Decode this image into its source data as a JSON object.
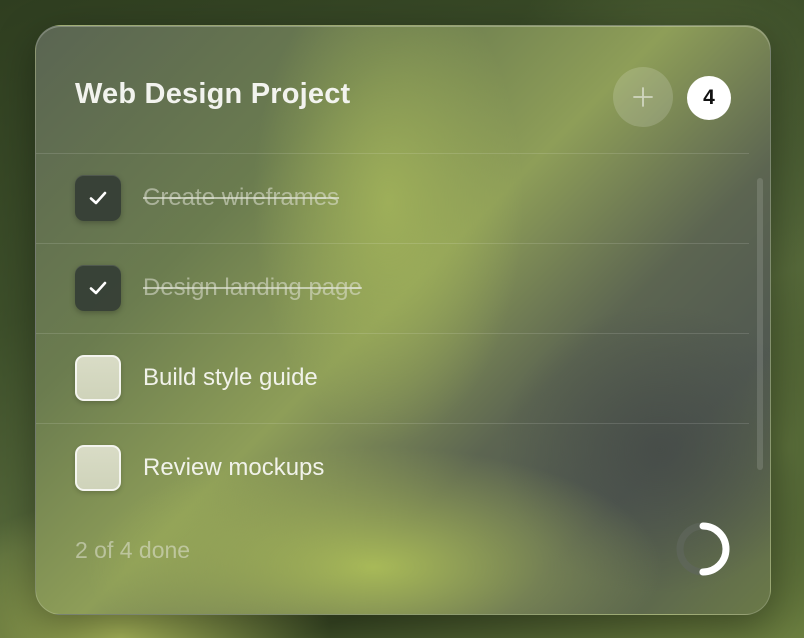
{
  "card": {
    "title": "Web Design Project",
    "add_icon": "plus-icon",
    "task_count": "4",
    "footer_text": "2 of 4 done",
    "progress_fraction": 0.5
  },
  "tasks": [
    {
      "label": "Create wireframes",
      "done": true
    },
    {
      "label": "Design landing page",
      "done": true
    },
    {
      "label": "Build style guide",
      "done": false
    },
    {
      "label": "Review mockups",
      "done": false
    }
  ],
  "colors": {
    "accent_green": "#a7b559",
    "ring": "#ffffff",
    "ring_track": "#5f665c"
  }
}
